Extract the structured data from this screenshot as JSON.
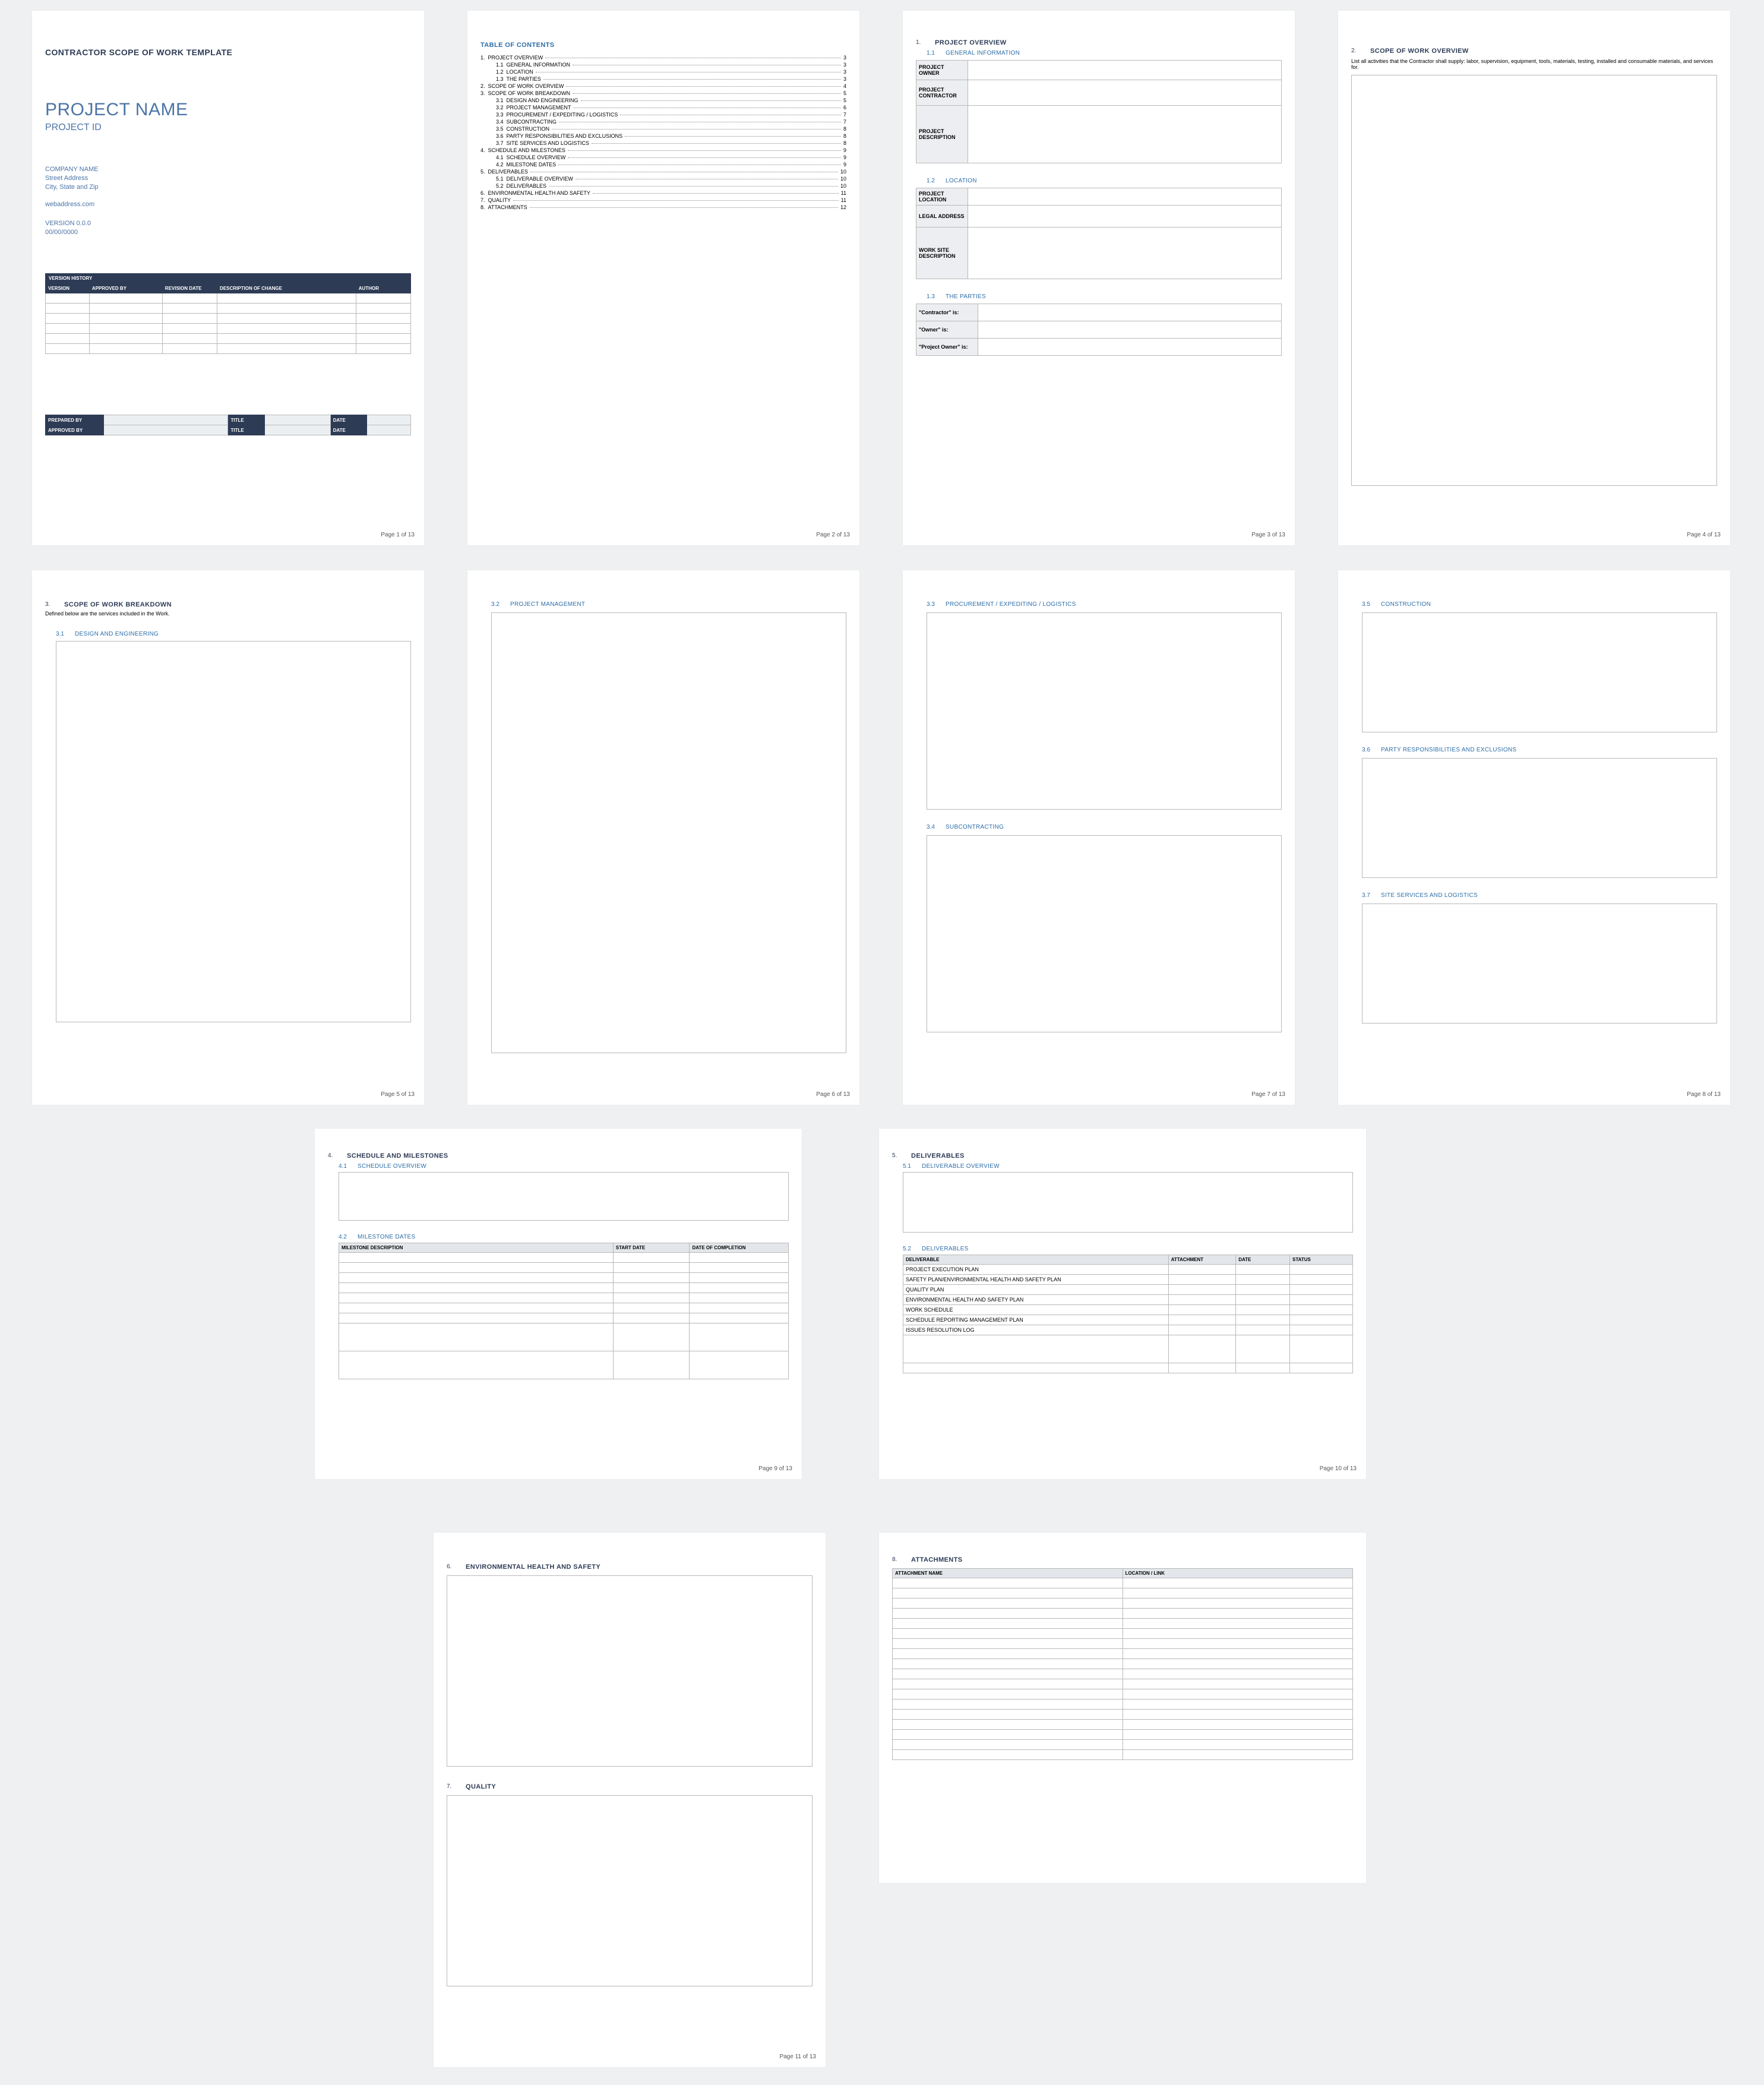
{
  "page_footer_prefix": "Page ",
  "page_footer_suffix": " of 13",
  "p1": {
    "doc_title": "CONTRACTOR SCOPE OF WORK TEMPLATE",
    "project_name": "PROJECT NAME",
    "project_id": "PROJECT ID",
    "company": "COMPANY NAME",
    "street": "Street Address",
    "city": "City, State and Zip",
    "web": "webaddress.com",
    "version": "VERSION 0.0.0",
    "date": "00/00/0000",
    "vh_title": "VERSION HISTORY",
    "vh_cols": [
      "VERSION",
      "APPROVED BY",
      "REVISION DATE",
      "DESCRIPTION OF CHANGE",
      "AUTHOR"
    ],
    "sig_rows": [
      [
        "PREPARED BY",
        "TITLE",
        "DATE"
      ],
      [
        "APPROVED BY",
        "TITLE",
        "DATE"
      ]
    ]
  },
  "p2": {
    "title": "TABLE OF CONTENTS",
    "items": [
      {
        "n": "1.",
        "t": "PROJECT OVERVIEW",
        "p": "3",
        "i": 0
      },
      {
        "n": "1.1",
        "t": "GENERAL INFORMATION",
        "p": "3",
        "i": 1
      },
      {
        "n": "1.2",
        "t": "LOCATION",
        "p": "3",
        "i": 1
      },
      {
        "n": "1.3",
        "t": "THE PARTIES",
        "p": "3",
        "i": 1
      },
      {
        "n": "2.",
        "t": "SCOPE OF WORK OVERVIEW",
        "p": "4",
        "i": 0
      },
      {
        "n": "3.",
        "t": "SCOPE OF WORK BREAKDOWN",
        "p": "5",
        "i": 0
      },
      {
        "n": "3.1",
        "t": "DESIGN AND ENGINEERING",
        "p": "5",
        "i": 1
      },
      {
        "n": "3.2",
        "t": "PROJECT MANAGEMENT",
        "p": "6",
        "i": 1
      },
      {
        "n": "3.3",
        "t": "PROCUREMENT / EXPEDITING / LOGISTICS",
        "p": "7",
        "i": 1
      },
      {
        "n": "3.4",
        "t": "SUBCONTRACTING",
        "p": "7",
        "i": 1
      },
      {
        "n": "3.5",
        "t": "CONSTRUCTION",
        "p": "8",
        "i": 1
      },
      {
        "n": "3.6",
        "t": "PARTY RESPONSIBILITIES AND EXCLUSIONS",
        "p": "8",
        "i": 1
      },
      {
        "n": "3.7",
        "t": "SITE SERVICES AND LOGISTICS",
        "p": "8",
        "i": 1
      },
      {
        "n": "4.",
        "t": "SCHEDULE AND MILESTONES",
        "p": "9",
        "i": 0
      },
      {
        "n": "4.1",
        "t": "SCHEDULE OVERVIEW",
        "p": "9",
        "i": 1
      },
      {
        "n": "4.2",
        "t": "MILESTONE DATES",
        "p": "9",
        "i": 1
      },
      {
        "n": "5.",
        "t": "DELIVERABLES",
        "p": "10",
        "i": 0
      },
      {
        "n": "5.1",
        "t": "DELIVERABLE OVERVIEW",
        "p": "10",
        "i": 1
      },
      {
        "n": "5.2",
        "t": "DELIVERABLES",
        "p": "10",
        "i": 1
      },
      {
        "n": "6.",
        "t": "ENVIRONMENTAL HEALTH AND SAFETY",
        "p": "11",
        "i": 0
      },
      {
        "n": "7.",
        "t": "QUALITY",
        "p": "11",
        "i": 0
      },
      {
        "n": "8.",
        "t": "ATTACHMENTS",
        "p": "12",
        "i": 0
      }
    ]
  },
  "p3": {
    "h1_n": "1.",
    "h1": "PROJECT OVERVIEW",
    "h11_n": "1.1",
    "h11": "GENERAL INFORMATION",
    "gi_rows": [
      "PROJECT OWNER",
      "PROJECT CONTRACTOR",
      "PROJECT DESCRIPTION"
    ],
    "h12_n": "1.2",
    "h12": "LOCATION",
    "loc_rows": [
      "PROJECT LOCATION",
      "LEGAL ADDRESS",
      "WORK SITE DESCRIPTION"
    ],
    "h13_n": "1.3",
    "h13": "THE PARTIES",
    "party_rows": [
      "\"Contractor\" is:",
      "\"Owner\" is:",
      "\"Project Owner\" is:"
    ]
  },
  "p4": {
    "h2_n": "2.",
    "h2": "SCOPE OF WORK OVERVIEW",
    "desc": "List all activities that the Contractor shall supply: labor, supervision, equipment, tools, materials, testing, installed and consumable materials, and services for."
  },
  "p5": {
    "h3_n": "3.",
    "h3": "SCOPE OF WORK BREAKDOWN",
    "sub": "Defined below are the services included in the Work.",
    "h31_n": "3.1",
    "h31": "DESIGN AND ENGINEERING"
  },
  "p6": {
    "h32_n": "3.2",
    "h32": "PROJECT MANAGEMENT"
  },
  "p7": {
    "h33_n": "3.3",
    "h33": "PROCUREMENT / EXPEDITING / LOGISTICS",
    "h34_n": "3.4",
    "h34": "SUBCONTRACTING"
  },
  "p8": {
    "h35_n": "3.5",
    "h35": "CONSTRUCTION",
    "h36_n": "3.6",
    "h36": "PARTY RESPONSIBILITIES AND EXCLUSIONS",
    "h37_n": "3.7",
    "h37": "SITE SERVICES AND LOGISTICS"
  },
  "p9": {
    "h4_n": "4.",
    "h4": "SCHEDULE AND MILESTONES",
    "h41_n": "4.1",
    "h41": "SCHEDULE OVERVIEW",
    "h42_n": "4.2",
    "h42": "MILESTONE DATES",
    "ms_cols": [
      "MILESTONE DESCRIPTION",
      "START DATE",
      "DATE OF COMPLETION"
    ]
  },
  "p10": {
    "h5_n": "5.",
    "h5": "DELIVERABLES",
    "h51_n": "5.1",
    "h51": "DELIVERABLE OVERVIEW",
    "h52_n": "5.2",
    "h52": "DELIVERABLES",
    "dl_cols": [
      "DELIVERABLE",
      "ATTACHMENT",
      "DATE",
      "STATUS"
    ],
    "dl_rows": [
      "PROJECT EXECUTION PLAN",
      "SAFETY PLAN/ENVIRONMENTAL HEALTH AND SAFETY PLAN",
      "QUALITY PLAN",
      "ENVIRONMENTAL HEALTH AND SAFETY PLAN",
      "WORK SCHEDULE",
      "SCHEDULE REPORTING MANAGEMENT PLAN",
      "ISSUES RESOLUTION LOG"
    ]
  },
  "p11": {
    "h6_n": "6.",
    "h6": "ENVIRONMENTAL HEALTH AND SAFETY",
    "h7_n": "7.",
    "h7": "QUALITY"
  },
  "p12": {
    "h8_n": "8.",
    "h8": "ATTACHMENTS",
    "att_cols": [
      "ATTACHMENT NAME",
      "LOCATION / LINK"
    ]
  }
}
